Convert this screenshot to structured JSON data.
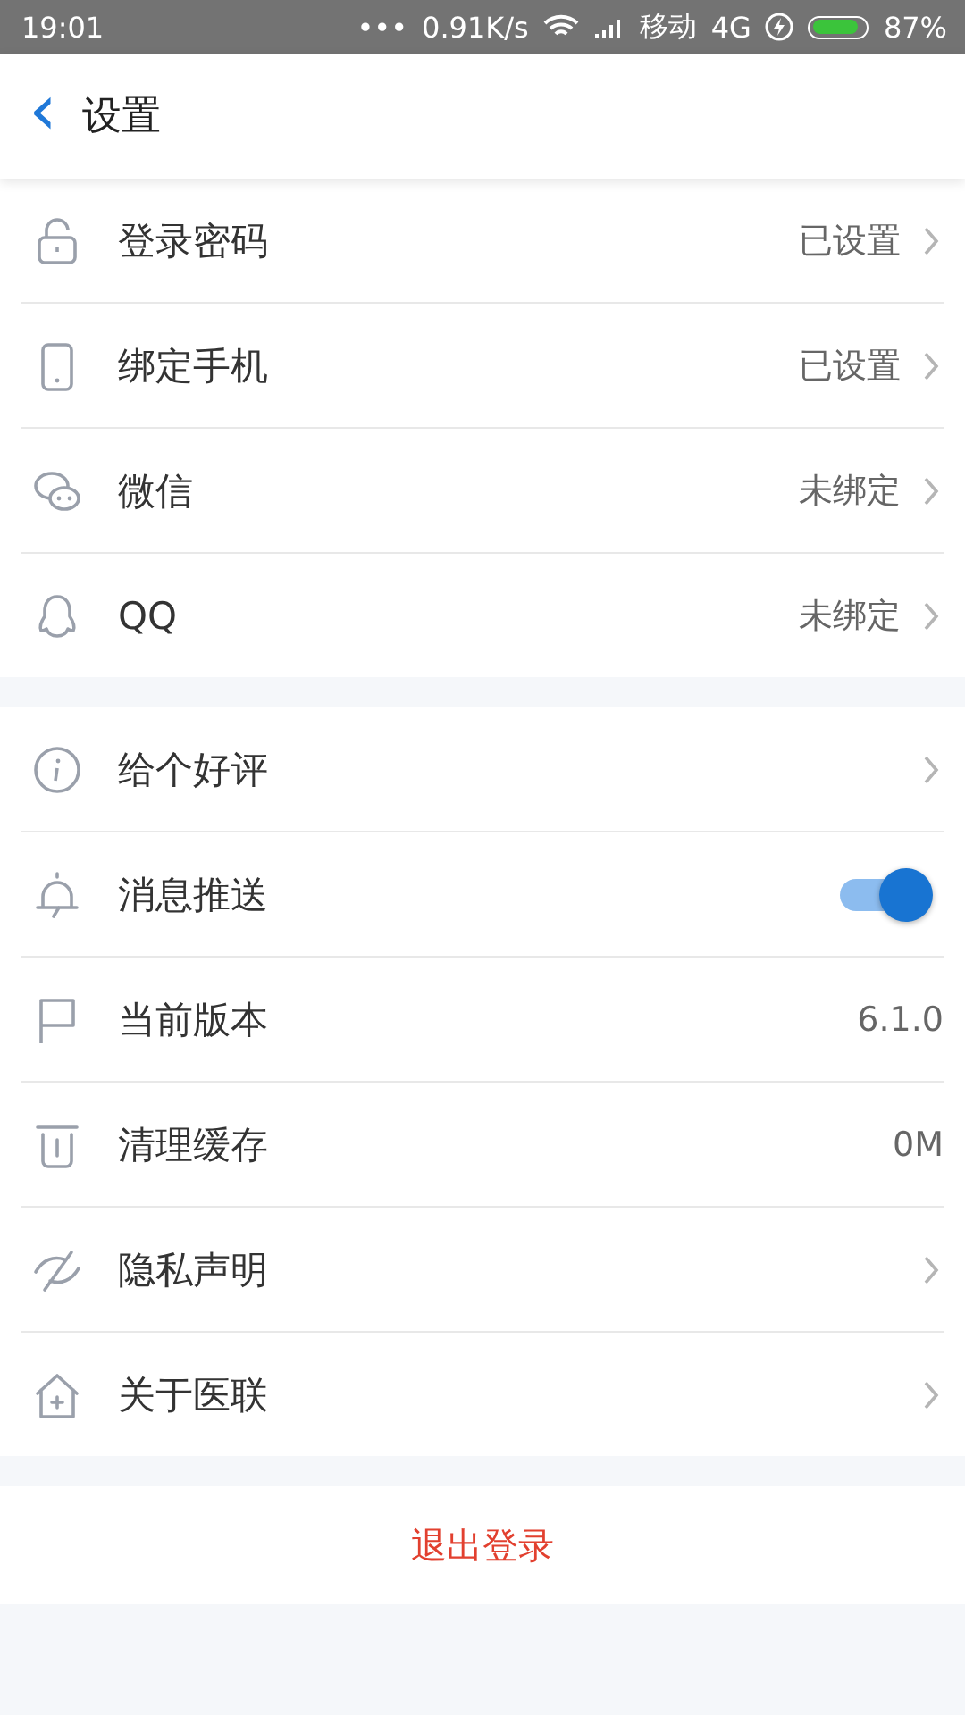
{
  "status_bar": {
    "time": "19:01",
    "dots": "•••",
    "speed": "0.91K/s",
    "carrier": "移动",
    "network": "4G",
    "battery": {
      "level": 0.87,
      "percent": "87%"
    }
  },
  "header": {
    "back": "‹",
    "title": "设置"
  },
  "groups": [
    {
      "items": [
        {
          "kind": "link",
          "label": "登录密码",
          "value": "已设置"
        },
        {
          "kind": "link",
          "label": "绑定手机",
          "value": "已设置"
        },
        {
          "kind": "link",
          "label": "微信",
          "value": "未绑定"
        },
        {
          "kind": "link",
          "label": "QQ",
          "value": "未绑定"
        }
      ]
    },
    {
      "items": [
        {
          "kind": "link",
          "label": "给个好评"
        },
        {
          "kind": "toggle",
          "label": "消息推送",
          "on": true
        },
        {
          "kind": "value",
          "label": "当前版本",
          "value": "6.1.0"
        },
        {
          "kind": "value",
          "label": "清理缓存",
          "value": "0M"
        },
        {
          "kind": "link",
          "label": "隐私声明"
        },
        {
          "kind": "link",
          "label": "关于医联"
        }
      ]
    }
  ],
  "logout": "退出登录"
}
